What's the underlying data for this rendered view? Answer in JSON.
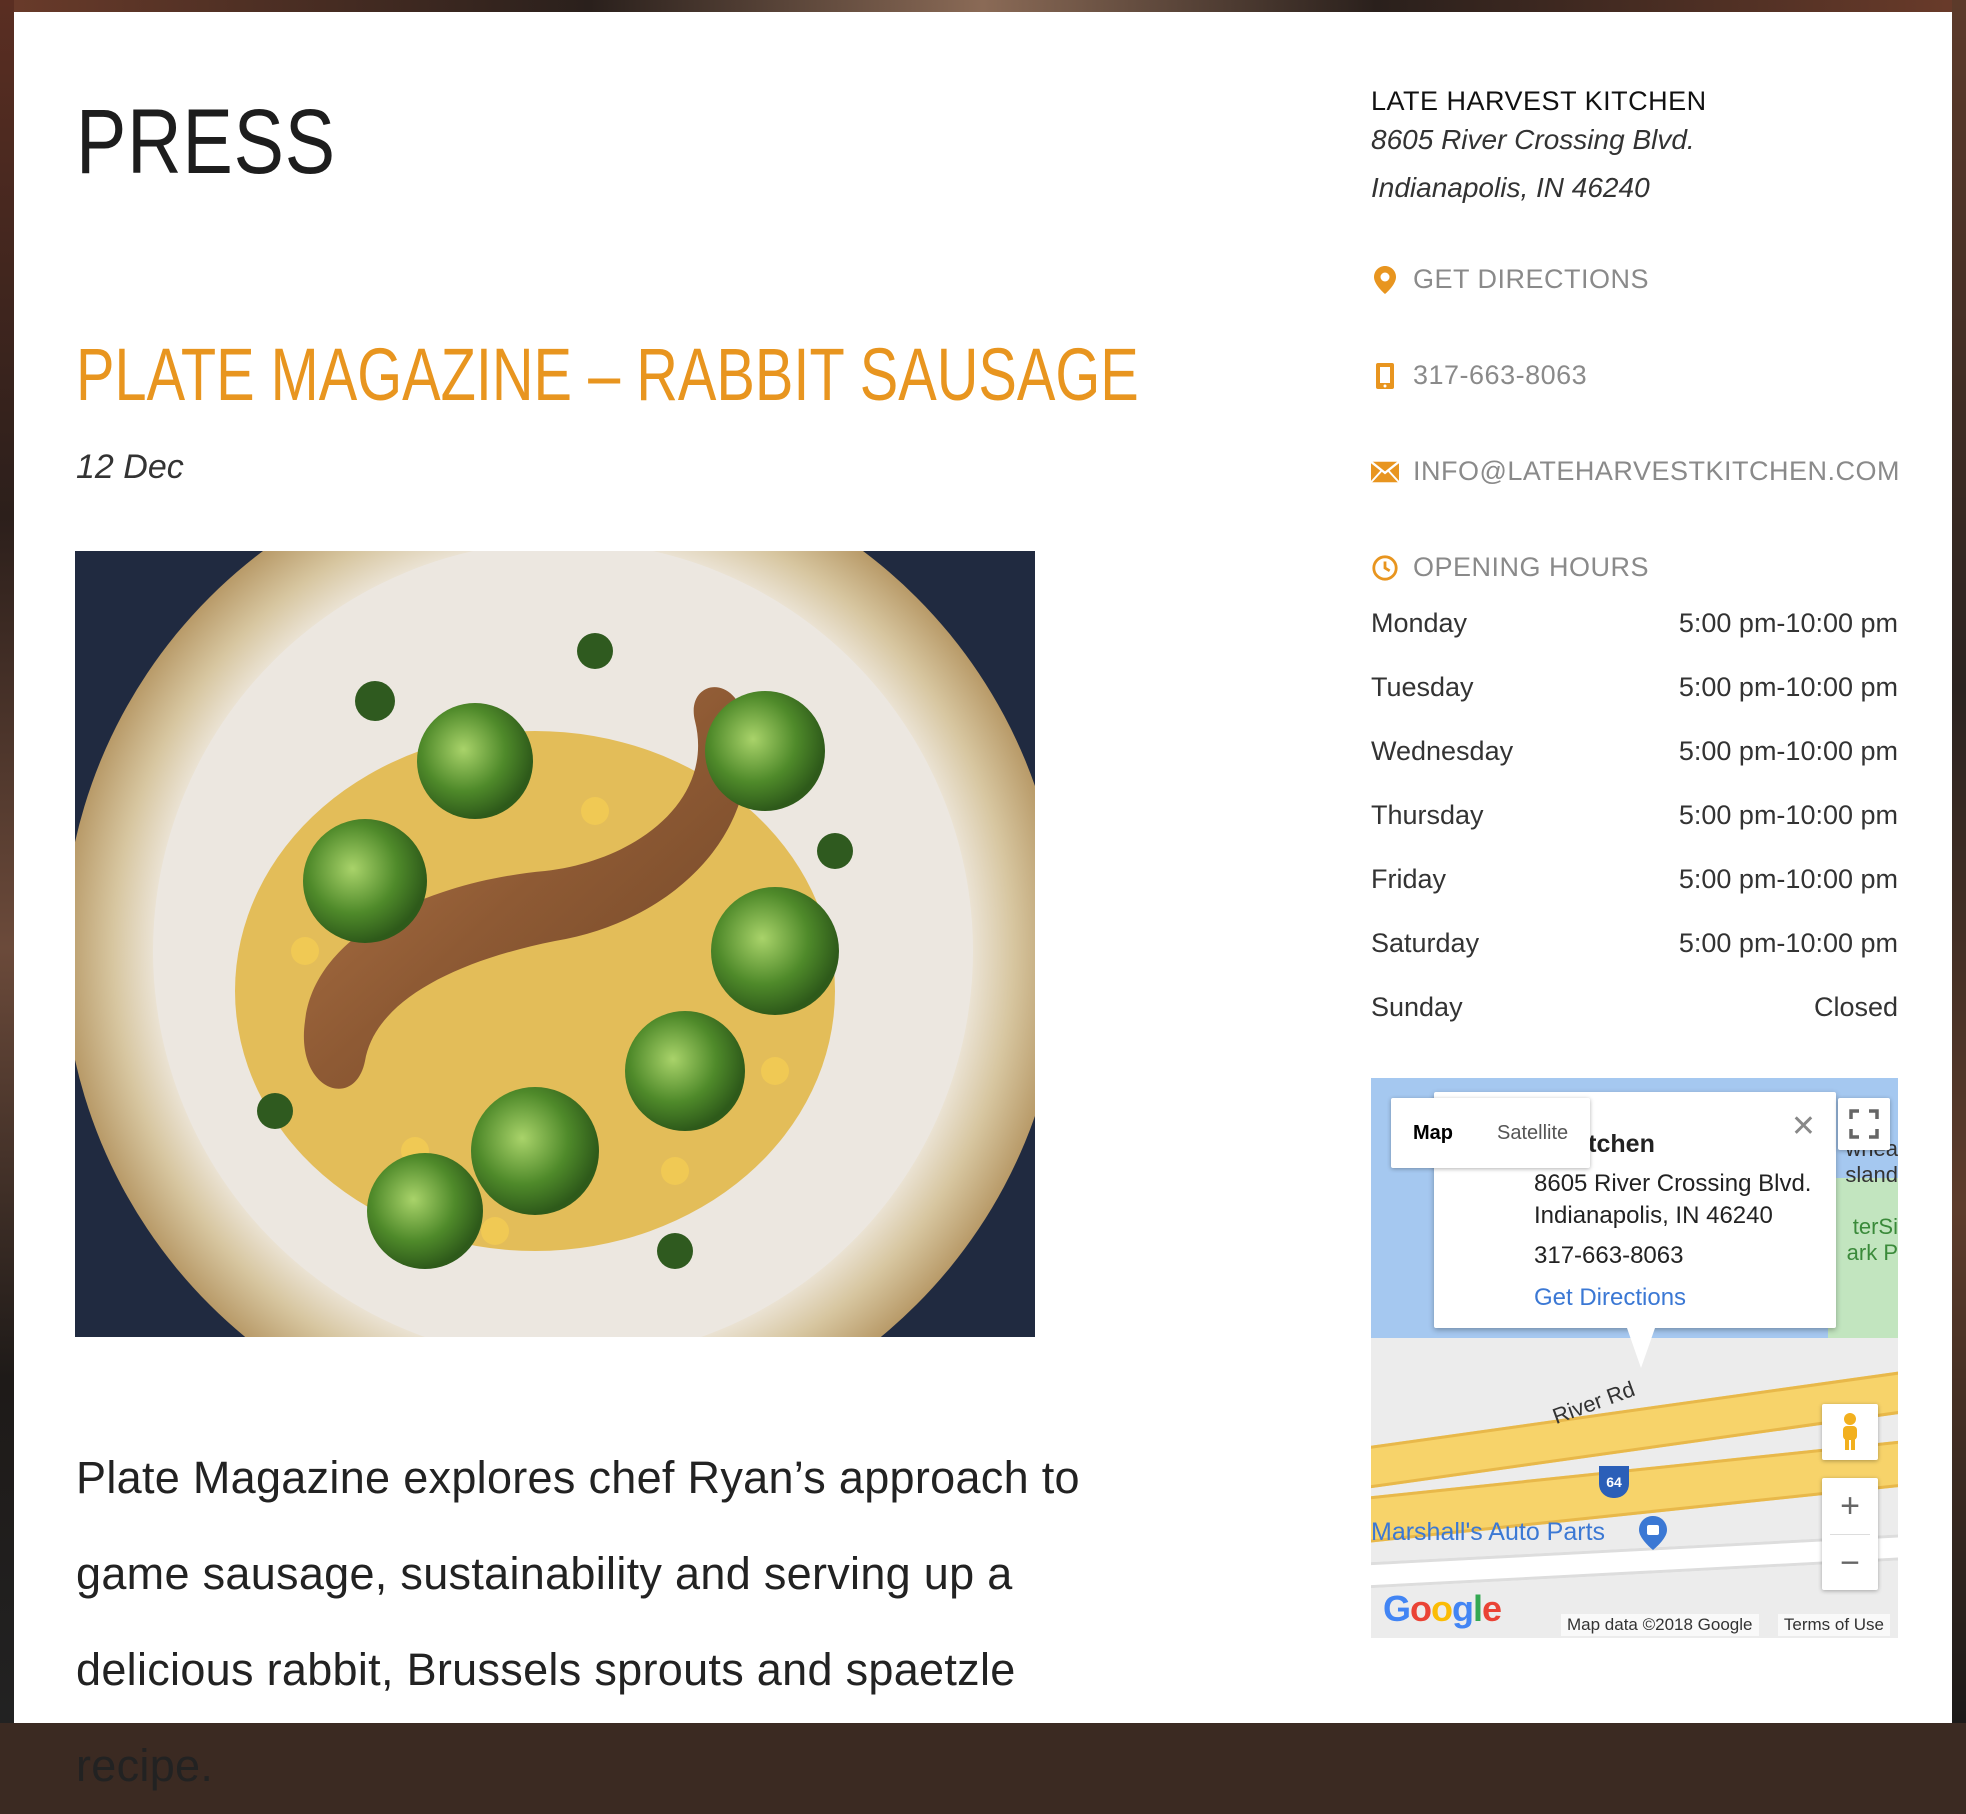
{
  "page": {
    "title": "PRESS"
  },
  "post": {
    "title": "PLATE MAGAZINE – RABBIT SAUSAGE",
    "date": "12 Dec",
    "body": "Plate Magazine explores chef Ryan’s approach to game sausage, sustainability and serving up a delicious rabbit, Brussels sprouts and spaetzle recipe."
  },
  "sidebar": {
    "business_name": "LATE HARVEST KITCHEN",
    "address_line1": "8605 River Crossing Blvd.",
    "address_line2": "Indianapolis, IN 46240",
    "directions_label": "GET DIRECTIONS",
    "phone": "317-663-8063",
    "email": "INFO@LATEHARVESTKITCHEN.COM",
    "hours_label": "OPENING HOURS",
    "hours": [
      {
        "day": "Monday",
        "time": "5:00 pm-10:00 pm"
      },
      {
        "day": "Tuesday",
        "time": "5:00 pm-10:00 pm"
      },
      {
        "day": "Wednesday",
        "time": "5:00 pm-10:00 pm"
      },
      {
        "day": "Thursday",
        "time": "5:00 pm-10:00 pm"
      },
      {
        "day": "Friday",
        "time": "5:00 pm-10:00 pm"
      },
      {
        "day": "Saturday",
        "time": "5:00 pm-10:00 pm"
      },
      {
        "day": "Sunday",
        "time": "Closed"
      }
    ],
    "accent_color": "#e8951f"
  },
  "map": {
    "type_map": "Map",
    "type_satellite": "Satellite",
    "popup_title": "st Kitchen",
    "popup_address1": "8605 River Crossing Blvd.",
    "popup_address2": "Indianapolis, IN 46240",
    "popup_phone": "317-663-8063",
    "popup_link": "Get Directions",
    "road_label": "River Rd",
    "interstate": "64",
    "place_label": "Marshall's Auto Parts",
    "edge_label_1": "wnea",
    "edge_label_2": "sland",
    "edge_label_3": "terSi",
    "edge_label_4": "ark P",
    "google": "Google",
    "attribution": "Map data ©2018 Google",
    "terms": "Terms of Use",
    "zoom_in": "+",
    "zoom_out": "−"
  }
}
